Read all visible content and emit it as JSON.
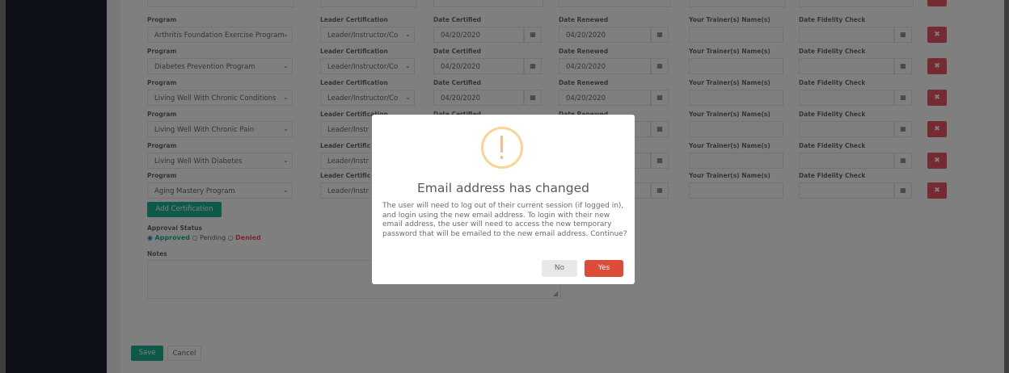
{
  "rows": [
    {
      "program": "Arthritis Foundation Exercise Program",
      "leader_cert": "Leader/Instructor/Co",
      "date_certified": "04/20/2020",
      "date_renewed": "04/20/2020"
    },
    {
      "program": "Diabetes Prevention Program",
      "leader_cert": "Leader/Instructor/Co",
      "date_certified": "04/20/2020",
      "date_renewed": "04/20/2020"
    },
    {
      "program": "Living Well With Chronic Conditions",
      "leader_cert": "Leader/Instructor/Co",
      "date_certified": "04/20/2020",
      "date_renewed": "04/20/2020"
    },
    {
      "program": "Living Well With Chronic Pain",
      "leader_cert": "Leader/Instr",
      "date_certified": "",
      "date_renewed": ""
    },
    {
      "program": "Living Well With Diabetes",
      "leader_cert": "Leader/Instr",
      "date_certified": "",
      "date_renewed": ""
    },
    {
      "program": "Aging Mastery Program",
      "leader_cert": "Leader/Instr",
      "date_certified": "",
      "date_renewed": ""
    }
  ],
  "labels": {
    "program": "Program",
    "leader_certification": "Leader Certification",
    "date_certified": "Date Certified",
    "date_renewed": "Date Renewed",
    "trainers": "Your Trainer(s) Name(s)",
    "fidelity": "Date Fidelity Check",
    "row3_leader": "Leader Certification",
    "row3_date_cert": "Date Certified",
    "row3_date_renew": "Date Renewed",
    "row45_leader": "Leader Certific"
  },
  "add_certification": "Add Certification",
  "approval": {
    "label": "Approval Status",
    "approved": "Approved",
    "pending": "Pending",
    "denied": "Denied"
  },
  "notes_label": "Notes",
  "footer": {
    "save": "Save",
    "cancel": "Cancel"
  },
  "modal": {
    "title": "Email address has changed",
    "text": "The user will need to log out of their current session (if logged in), and login using the new email address. To login with their new email address, the user will need to access the new temporary password that will be emailed to the new email address. Continue?",
    "no": "No",
    "yes": "Yes"
  },
  "icons": {
    "calendar": "calendar-icon",
    "delete": "times-icon",
    "chevron": "chevron-down-icon",
    "warning": "warning-icon"
  },
  "colors": {
    "danger": "#ed5565",
    "primary": "#1ab394",
    "yes_button": "#dd4b39",
    "sidebar": "#1d2530"
  }
}
